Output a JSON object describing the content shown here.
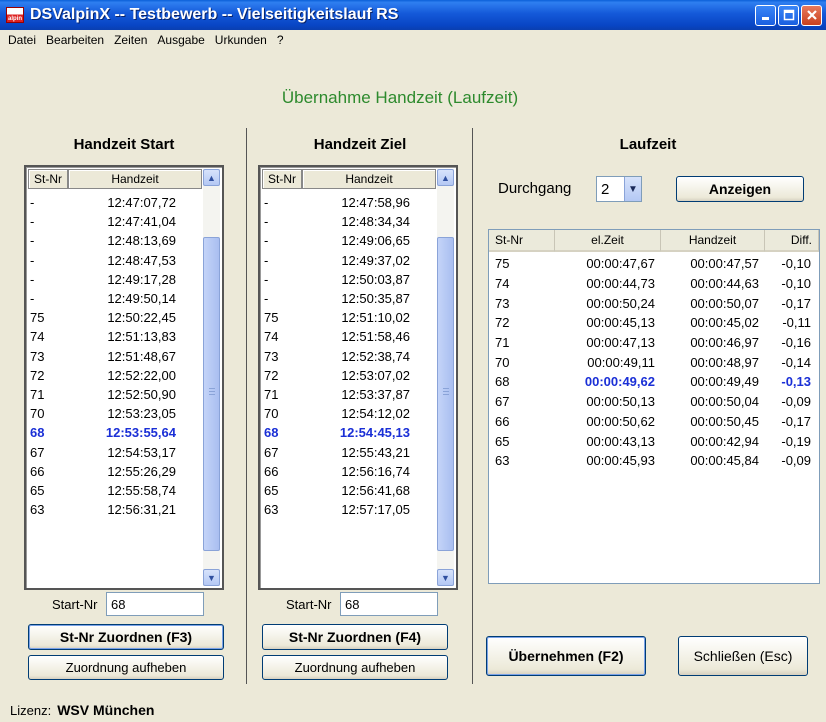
{
  "window": {
    "title": "DSValpinX -- Testbewerb -- Vielseitigkeitslauf RS",
    "icon_text": "alpin",
    "buttons": [
      "minimize-icon",
      "maximize-icon",
      "close-icon"
    ]
  },
  "menu": [
    "Datei",
    "Bearbeiten",
    "Zeiten",
    "Ausgabe",
    "Urkunden",
    "?"
  ],
  "header": {
    "title": "Übernahme Handzeit (Laufzeit)"
  },
  "start": {
    "title": "Handzeit Start",
    "col_stnr": "St-Nr",
    "col_handzeit": "Handzeit",
    "rows": [
      {
        "nr": "-",
        "zeit": "12:47:07,72"
      },
      {
        "nr": "-",
        "zeit": "12:47:41,04"
      },
      {
        "nr": "-",
        "zeit": "12:48:13,69"
      },
      {
        "nr": "-",
        "zeit": "12:48:47,53"
      },
      {
        "nr": "-",
        "zeit": "12:49:17,28"
      },
      {
        "nr": "-",
        "zeit": "12:49:50,14"
      },
      {
        "nr": "75",
        "zeit": "12:50:22,45"
      },
      {
        "nr": "74",
        "zeit": "12:51:13,83"
      },
      {
        "nr": "73",
        "zeit": "12:51:48,67"
      },
      {
        "nr": "72",
        "zeit": "12:52:22,00"
      },
      {
        "nr": "71",
        "zeit": "12:52:50,90"
      },
      {
        "nr": "70",
        "zeit": "12:53:23,05"
      },
      {
        "nr": "68",
        "zeit": "12:53:55,64",
        "hl": true
      },
      {
        "nr": "67",
        "zeit": "12:54:53,17"
      },
      {
        "nr": "66",
        "zeit": "12:55:26,29"
      },
      {
        "nr": "65",
        "zeit": "12:55:58,74"
      },
      {
        "nr": "63",
        "zeit": "12:56:31,21"
      }
    ],
    "startnr_label": "Start-Nr",
    "startnr_value": "68",
    "assign_button": "St-Nr Zuordnen (F3)",
    "unassign_button": "Zuordnung aufheben"
  },
  "ziel": {
    "title": "Handzeit Ziel",
    "col_stnr": "St-Nr",
    "col_handzeit": "Handzeit",
    "rows": [
      {
        "nr": "-",
        "zeit": "12:47:58,96"
      },
      {
        "nr": "-",
        "zeit": "12:48:34,34"
      },
      {
        "nr": "-",
        "zeit": "12:49:06,65"
      },
      {
        "nr": "-",
        "zeit": "12:49:37,02"
      },
      {
        "nr": "-",
        "zeit": "12:50:03,87"
      },
      {
        "nr": "-",
        "zeit": "12:50:35,87"
      },
      {
        "nr": "75",
        "zeit": "12:51:10,02"
      },
      {
        "nr": "74",
        "zeit": "12:51:58,46"
      },
      {
        "nr": "73",
        "zeit": "12:52:38,74"
      },
      {
        "nr": "72",
        "zeit": "12:53:07,02"
      },
      {
        "nr": "71",
        "zeit": "12:53:37,87"
      },
      {
        "nr": "70",
        "zeit": "12:54:12,02"
      },
      {
        "nr": "68",
        "zeit": "12:54:45,13",
        "hl": true
      },
      {
        "nr": "67",
        "zeit": "12:55:43,21"
      },
      {
        "nr": "66",
        "zeit": "12:56:16,74"
      },
      {
        "nr": "65",
        "zeit": "12:56:41,68"
      },
      {
        "nr": "63",
        "zeit": "12:57:17,05"
      }
    ],
    "startnr_label": "Start-Nr",
    "startnr_value": "68",
    "assign_button": "St-Nr Zuordnen (F4)",
    "unassign_button": "Zuordnung aufheben"
  },
  "laufzeit": {
    "title": "Laufzeit",
    "durchgang_label": "Durchgang",
    "durchgang_value": "2",
    "show_button": "Anzeigen",
    "columns": [
      "St-Nr",
      "el.Zeit",
      "Handzeit",
      "Diff."
    ],
    "rows": [
      {
        "nr": "75",
        "el": "00:00:47,67",
        "hand": "00:00:47,57",
        "diff": "-0,10"
      },
      {
        "nr": "74",
        "el": "00:00:44,73",
        "hand": "00:00:44,63",
        "diff": "-0,10"
      },
      {
        "nr": "73",
        "el": "00:00:50,24",
        "hand": "00:00:50,07",
        "diff": "-0,17"
      },
      {
        "nr": "72",
        "el": "00:00:45,13",
        "hand": "00:00:45,02",
        "diff": "-0,11"
      },
      {
        "nr": "71",
        "el": "00:00:47,13",
        "hand": "00:00:46,97",
        "diff": "-0,16"
      },
      {
        "nr": "70",
        "el": "00:00:49,11",
        "hand": "00:00:48,97",
        "diff": "-0,14"
      },
      {
        "nr": "68",
        "el": "00:00:49,62",
        "hand": "00:00:49,49",
        "diff": "-0,13",
        "hl": true
      },
      {
        "nr": "67",
        "el": "00:00:50,13",
        "hand": "00:00:50,04",
        "diff": "-0,09"
      },
      {
        "nr": "66",
        "el": "00:00:50,62",
        "hand": "00:00:50,45",
        "diff": "-0,17"
      },
      {
        "nr": "65",
        "el": "00:00:43,13",
        "hand": "00:00:42,94",
        "diff": "-0,19"
      },
      {
        "nr": "63",
        "el": "00:00:45,93",
        "hand": "00:00:45,84",
        "diff": "-0,09"
      }
    ],
    "apply_button": "Übernehmen (F2)",
    "close_button": "Schließen (Esc)"
  },
  "status": {
    "label": "Lizenz:",
    "value": "WSV München"
  },
  "colors": {
    "highlight": "#1a2fd6",
    "header_green": "#2d8a2d",
    "titlebar": "#0a4fd0"
  }
}
